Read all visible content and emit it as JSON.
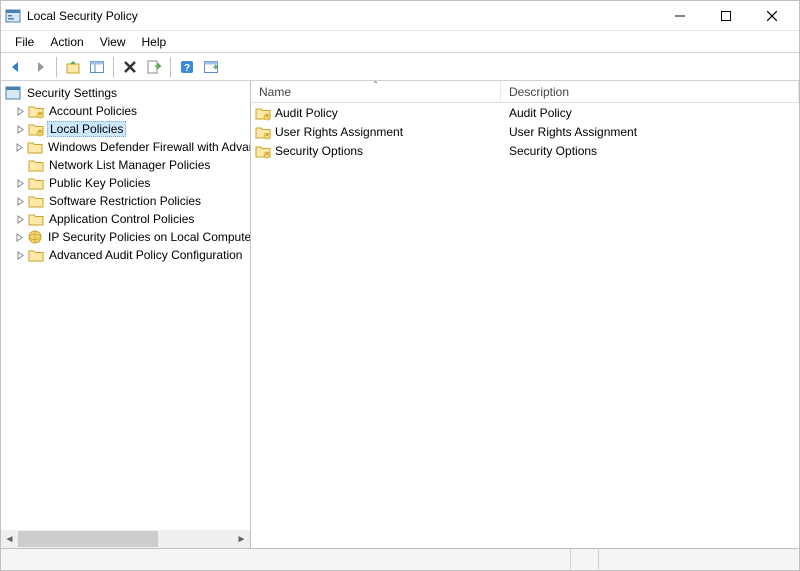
{
  "window": {
    "title": "Local Security Policy"
  },
  "menu": {
    "file": "File",
    "action": "Action",
    "view": "View",
    "help": "Help"
  },
  "tree": {
    "root": "Security Settings",
    "nodes": [
      {
        "label": "Account Policies",
        "icon": "folder-lock",
        "selected": false
      },
      {
        "label": "Local Policies",
        "icon": "folder-lock",
        "selected": true
      },
      {
        "label": "Windows Defender Firewall with Advanced Security",
        "icon": "folder",
        "selected": false
      },
      {
        "label": "Network List Manager Policies",
        "icon": "folder",
        "selected": false
      },
      {
        "label": "Public Key Policies",
        "icon": "folder",
        "selected": false
      },
      {
        "label": "Software Restriction Policies",
        "icon": "folder",
        "selected": false
      },
      {
        "label": "Application Control Policies",
        "icon": "folder",
        "selected": false
      },
      {
        "label": "IP Security Policies on Local Computer",
        "icon": "globe",
        "selected": false
      },
      {
        "label": "Advanced Audit Policy Configuration",
        "icon": "folder",
        "selected": false
      }
    ]
  },
  "list": {
    "columns": {
      "name": "Name",
      "description": "Description"
    },
    "rows": [
      {
        "name": "Audit Policy",
        "description": "Audit Policy"
      },
      {
        "name": "User Rights Assignment",
        "description": "User Rights Assignment"
      },
      {
        "name": "Security Options",
        "description": "Security Options"
      }
    ]
  }
}
